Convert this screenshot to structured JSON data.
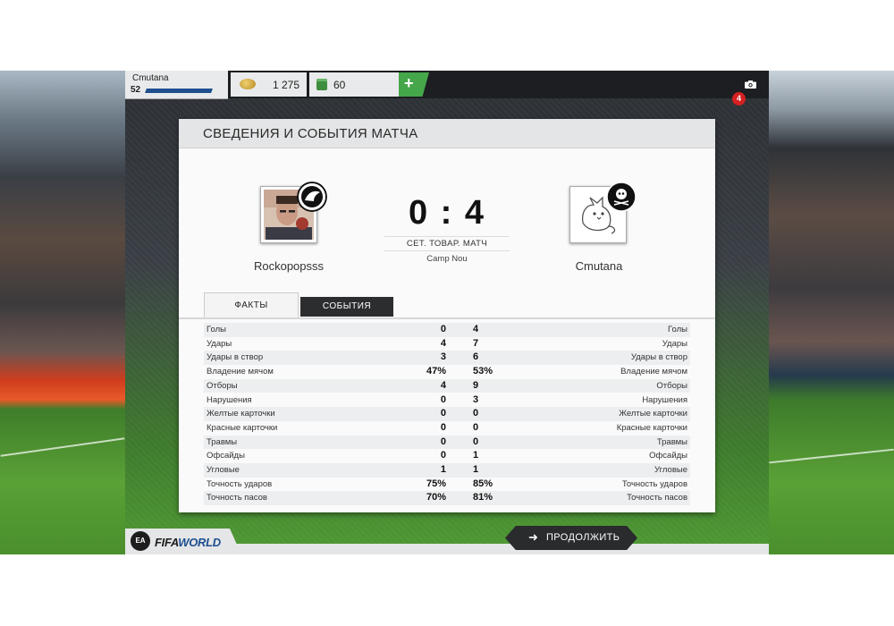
{
  "user": {
    "name": "Cmutana",
    "level": "52"
  },
  "currency": {
    "coins": "1 275",
    "points": "60",
    "add_label": "+"
  },
  "notifications": {
    "count": "4"
  },
  "panel": {
    "title": "СВЕДЕНИЯ И СОБЫТИЯ МАТЧА"
  },
  "match": {
    "home_team": "Rockopopsss",
    "away_team": "Cmutana",
    "score": "0 : 4",
    "type": "СЕТ. ТОВАР. МАТЧ",
    "venue": "Camp Nou"
  },
  "tabs": {
    "facts": "ФАКТЫ",
    "events": "СОБЫТИЯ"
  },
  "stats": [
    {
      "label": "Голы",
      "home": "0",
      "away": "4"
    },
    {
      "label": "Удары",
      "home": "4",
      "away": "7"
    },
    {
      "label": "Удары в створ",
      "home": "3",
      "away": "6"
    },
    {
      "label": "Владение мячом",
      "home": "47%",
      "away": "53%"
    },
    {
      "label": "Отборы",
      "home": "4",
      "away": "9"
    },
    {
      "label": "Нарушения",
      "home": "0",
      "away": "3"
    },
    {
      "label": "Желтые карточки",
      "home": "0",
      "away": "0"
    },
    {
      "label": "Красные карточки",
      "home": "0",
      "away": "0"
    },
    {
      "label": "Травмы",
      "home": "0",
      "away": "0"
    },
    {
      "label": "Офсайды",
      "home": "0",
      "away": "1"
    },
    {
      "label": "Угловые",
      "home": "1",
      "away": "1"
    },
    {
      "label": "Точность ударов",
      "home": "75%",
      "away": "85%"
    },
    {
      "label": "Точность пасов",
      "home": "70%",
      "away": "81%"
    }
  ],
  "footer": {
    "continue_label": "ПРОДОЛЖИТЬ",
    "ea_label": "EA",
    "logo_main": "FIFA",
    "logo_accent": "WORLD"
  },
  "colors": {
    "accent_green": "#45a64a",
    "dark": "#2c2d2f",
    "badge_red": "#d62020"
  },
  "icons": [
    "coin-icon",
    "points-icon",
    "camera-icon",
    "arrow-right-icon",
    "swansea-crest-icon",
    "pirates-crest-icon"
  ]
}
